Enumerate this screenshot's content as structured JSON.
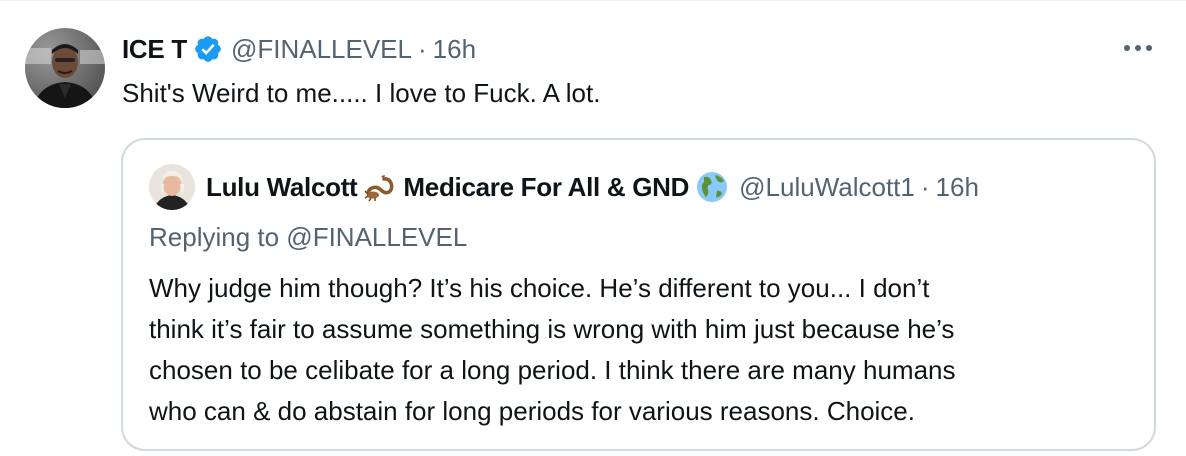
{
  "tweet": {
    "display_name": "ICE T",
    "handle": "@FINALLEVEL",
    "separator": "·",
    "time": "16h",
    "text": "Shit's Weird to me..... I love to Fuck. A lot.",
    "avatar_icon": "profile-photo-icon",
    "verified_icon": "verified-badge-icon",
    "more_icon": "more-options-icon"
  },
  "quote": {
    "display_name_part1": "Lulu Walcott",
    "display_name_part2": "Medicare For All & GND",
    "emoji_1": "scorpion-icon",
    "emoji_2": "globe-americas-icon",
    "handle": "@LuluWalcott1",
    "separator": "·",
    "time": "16h",
    "replying_to": "Replying to @FINALLEVEL",
    "body_lines": [
      "Why judge him though? It’s his choice. He’s different to you... I don’t",
      "think it’s fair to assume something is wrong with him just because he’s",
      "chosen to be celibate for a long period. I think there are many humans",
      "who can & do abstain for long periods for various reasons. Choice."
    ]
  },
  "colors": {
    "text_primary": "#0f1419",
    "text_secondary": "#536471",
    "verified_blue": "#1d9bf0",
    "quote_border": "#cfd9de"
  }
}
